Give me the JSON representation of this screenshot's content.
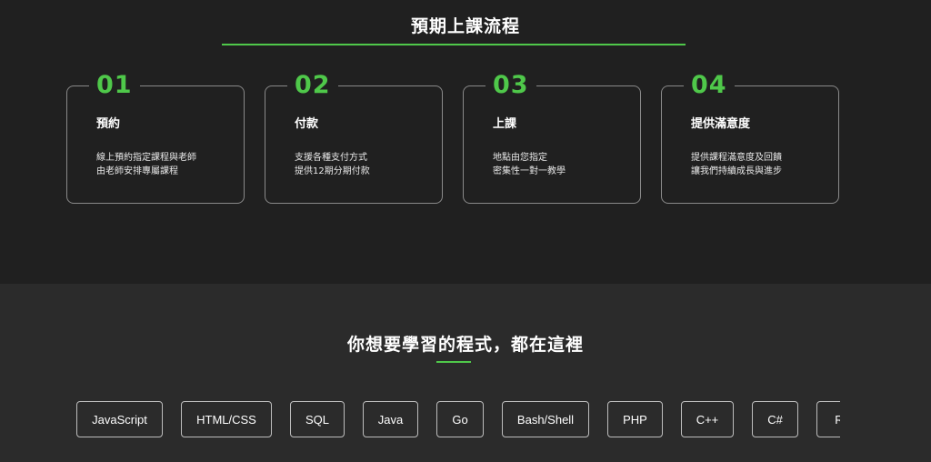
{
  "process": {
    "title": "預期上課流程",
    "steps": [
      {
        "number": "01",
        "title": "預約",
        "lines": [
          "線上預約指定課程與老師",
          "由老師安排專屬課程"
        ]
      },
      {
        "number": "02",
        "title": "付款",
        "lines": [
          "支援各種支付方式",
          "提供12期分期付款"
        ]
      },
      {
        "number": "03",
        "title": "上課",
        "lines": [
          "地點由您指定",
          "密集性一對一教學"
        ]
      },
      {
        "number": "04",
        "title": "提供滿意度",
        "lines": [
          "提供課程滿意度及回饋",
          "讓我們持續成長與進步"
        ]
      }
    ]
  },
  "languages": {
    "title": "你想要學習的程式，都在這裡",
    "tags": [
      "JavaScript",
      "HTML/CSS",
      "SQL",
      "Java",
      "Go",
      "Bash/Shell",
      "PHP",
      "C++",
      "C#",
      "R"
    ]
  },
  "colors": {
    "accent": "#4fc84a",
    "background_top": "#202020",
    "background_bottom": "#2b2b2b"
  }
}
